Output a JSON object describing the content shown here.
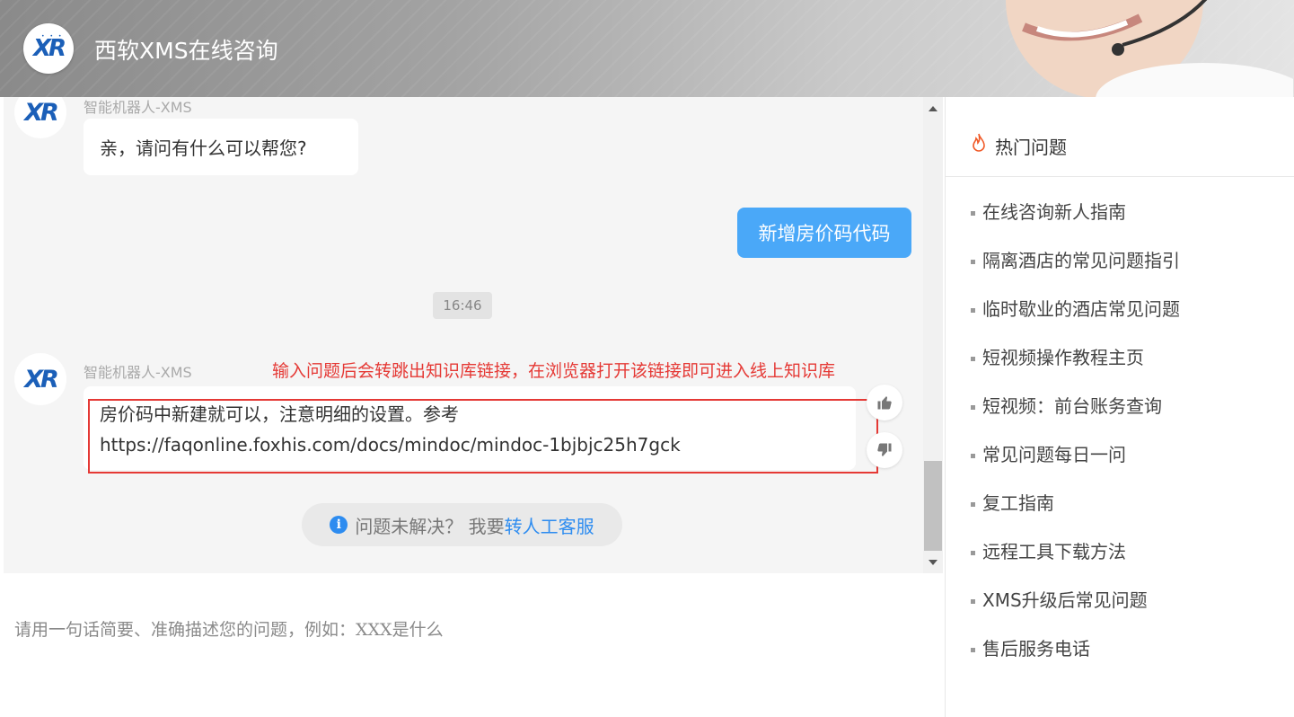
{
  "header": {
    "title": "西软XMS在线咨询",
    "logo_text": "XR"
  },
  "chat": {
    "bot_name": "智能机器人-XMS",
    "greeting": "亲，请问有什么可以帮您?",
    "user_message": "新增房价码代码",
    "timestamp": "16:46",
    "annotation": "输入问题后会转跳出知识库链接，在浏览器打开该链接即可进入线上知识库",
    "answer_line1": "房价码中新建就可以，注意明细的设置。参考",
    "answer_line2": "https://faqonline.foxhis.com/docs/mindoc/mindoc-1bjbjc25h7gck",
    "transfer_prefix": "问题未解决？ 我要",
    "transfer_link": "转人工客服"
  },
  "input": {
    "placeholder": "请用一句话简要、准确描述您的问题，例如：XXX是什么"
  },
  "sidebar": {
    "title": "热门问题",
    "items": [
      {
        "label": "在线咨询新人指南"
      },
      {
        "label": "隔离酒店的常见问题指引"
      },
      {
        "label": "临时歇业的酒店常见问题"
      },
      {
        "label": "短视频操作教程主页"
      },
      {
        "label": "短视频：前台账务查询"
      },
      {
        "label": "常见问题每日一问"
      },
      {
        "label": "复工指南"
      },
      {
        "label": "远程工具下载方法"
      },
      {
        "label": "XMS升级后常见问题"
      },
      {
        "label": "售后服务电话"
      }
    ]
  },
  "colors": {
    "accent": "#4aa8f8",
    "link": "#2d8cf0",
    "annotation": "#e53935"
  }
}
